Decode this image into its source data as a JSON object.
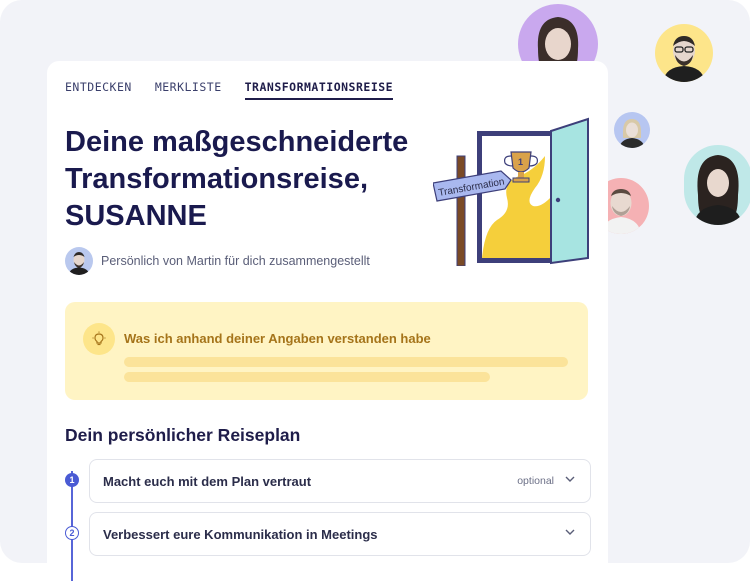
{
  "tabs": [
    {
      "label": "ENTDECKEN",
      "active": false
    },
    {
      "label": "MERKLISTE",
      "active": false
    },
    {
      "label": "TRANSFORMATIONSREISE",
      "active": true
    }
  ],
  "header": {
    "title_line1": "Deine maßgeschneiderte",
    "title_line2": "Transformationsreise,",
    "title_line3": "SUSANNE",
    "subtitle": "Persönlich von Martin für dich zusammengestellt"
  },
  "illustration": {
    "sign_text": "Transformation",
    "trophy_number": "1"
  },
  "insight": {
    "icon": "lightbulb-icon",
    "title": "Was ich anhand deiner Angaben verstanden habe"
  },
  "plan": {
    "title": "Dein persönlicher Reiseplan",
    "steps": [
      {
        "number": "1",
        "label": "Macht euch mit dem Plan vertraut",
        "tag": "optional"
      },
      {
        "number": "2",
        "label": "Verbessert eure Kommunikation in Meetings",
        "tag": ""
      }
    ]
  },
  "colors": {
    "accent": "#4a5bd4",
    "title": "#1a1a4e",
    "insight_bg": "#fff4c4",
    "insight_text": "#a5741a"
  }
}
